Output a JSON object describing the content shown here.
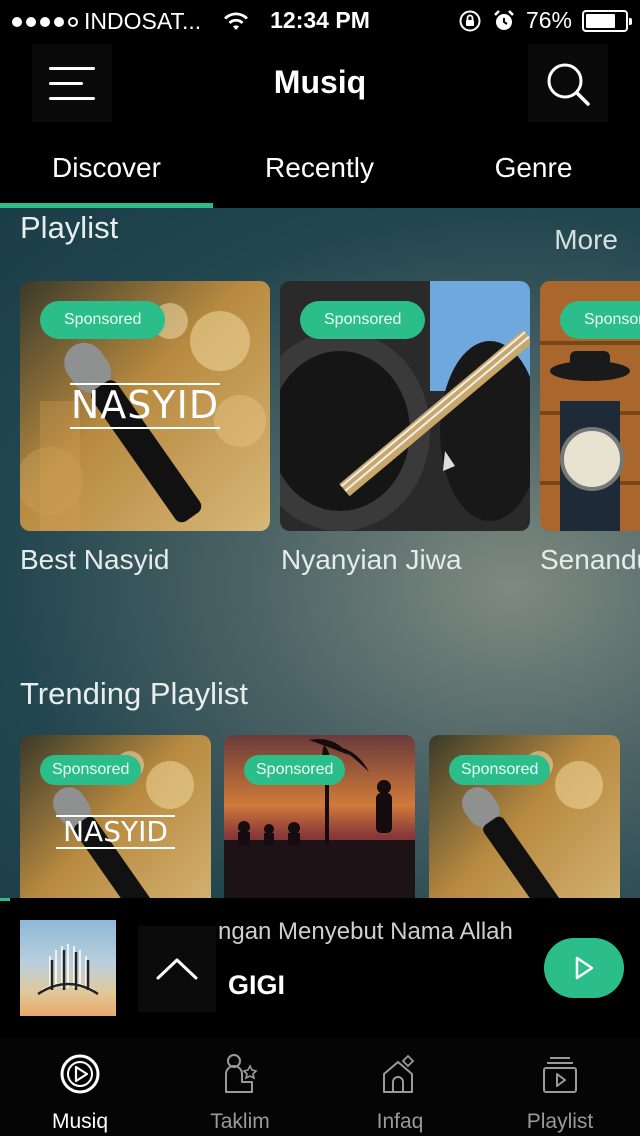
{
  "status_bar": {
    "carrier": "INDOSAT...",
    "time": "12:34 PM",
    "battery": "76%",
    "battery_level": 0.76
  },
  "header": {
    "title": "Musiq",
    "menu_icon": "hamburger-menu-icon",
    "search_icon": "search-icon"
  },
  "tabs": [
    {
      "label": "Discover",
      "active": true
    },
    {
      "label": "Recently",
      "active": false
    },
    {
      "label": "Genre",
      "active": false
    }
  ],
  "playlist_section": {
    "title": "Playlist",
    "more_label": "More",
    "cards": [
      {
        "badge": "Sponsored",
        "title": "Best Nasyid",
        "art_text": "NASYID"
      },
      {
        "badge": "Sponsored",
        "title": "Nyanyian Jiwa"
      },
      {
        "badge": "Sponsor",
        "title": "Senandu"
      }
    ]
  },
  "trending_section": {
    "title": "Trending Playlist",
    "cards": [
      {
        "badge": "Sponsored",
        "art_text": "NASYID"
      },
      {
        "badge": "Sponsored"
      },
      {
        "badge": "Sponsored"
      }
    ]
  },
  "player": {
    "song_title": "ngan Menyebut Nama Allah",
    "artist": "GIGI",
    "expand_icon": "chevron-up-icon",
    "play_icon": "play-icon"
  },
  "bottom_nav": [
    {
      "label": "Musiq",
      "icon": "play-circle-icon",
      "active": true
    },
    {
      "label": "Taklim",
      "icon": "teacher-icon",
      "active": false
    },
    {
      "label": "Infaq",
      "icon": "donation-house-icon",
      "active": false
    },
    {
      "label": "Playlist",
      "icon": "playlist-stack-icon",
      "active": false
    }
  ],
  "colors": {
    "accent": "#2bbd8a",
    "background": "#000000"
  }
}
